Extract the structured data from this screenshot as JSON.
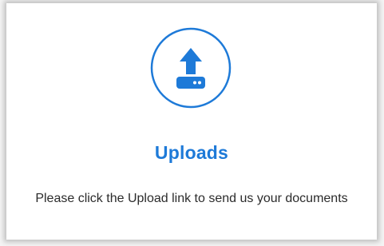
{
  "uploads_card": {
    "icon": "upload-icon",
    "title": "Uploads",
    "description": "Please click the Upload link to send us your documents",
    "accent_color": "#1e7ad8"
  }
}
